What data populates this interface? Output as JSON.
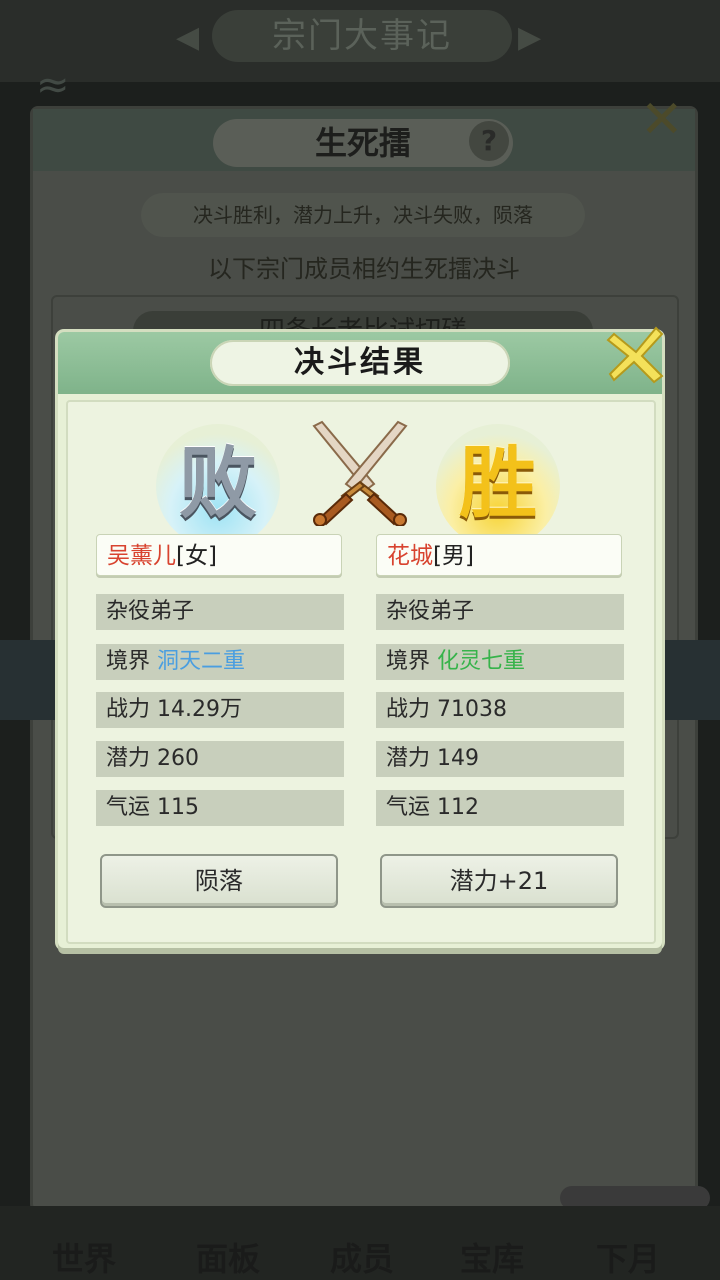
{
  "background": {
    "top_title": "宗门大事记",
    "panel_title": "生死擂",
    "help_glyph": "?",
    "rule_text": "决斗胜利，潜力上升，决斗失败，陨落",
    "description": "以下宗门成员相约生死擂决斗",
    "list_item_partial": "四条长老比试切磋",
    "nav": [
      "世界",
      "面板",
      "成员",
      "宝库",
      "下月"
    ]
  },
  "dialog": {
    "title": "决斗结果",
    "loser": {
      "badge": "败",
      "name": "吴薰儿",
      "gender": "[女]",
      "rank": "杂役弟子",
      "realm_label": "境界",
      "realm_value": "洞天二重",
      "power_label": "战力",
      "power_value": "14.29万",
      "potential_label": "潜力",
      "potential_value": "260",
      "luck_label": "气运",
      "luck_value": "115",
      "result_button": "陨落"
    },
    "winner": {
      "badge": "胜",
      "name": "花城",
      "gender": "[男]",
      "rank": "杂役弟子",
      "realm_label": "境界",
      "realm_value": "化灵七重",
      "power_label": "战力",
      "power_value": "71038",
      "potential_label": "潜力",
      "potential_value": "149",
      "luck_label": "气运",
      "luck_value": "112",
      "result_button": "潜力+21"
    }
  },
  "colors": {
    "loser_name": "#d8432f",
    "realm_loser": "#4a9ee0",
    "realm_winner": "#36b34a",
    "dialog_bg": "#e7f0d6",
    "dialog_header": "#8fbf98"
  },
  "icons": [
    "crossed-swords-icon",
    "close-x-icon",
    "help-icon"
  ]
}
